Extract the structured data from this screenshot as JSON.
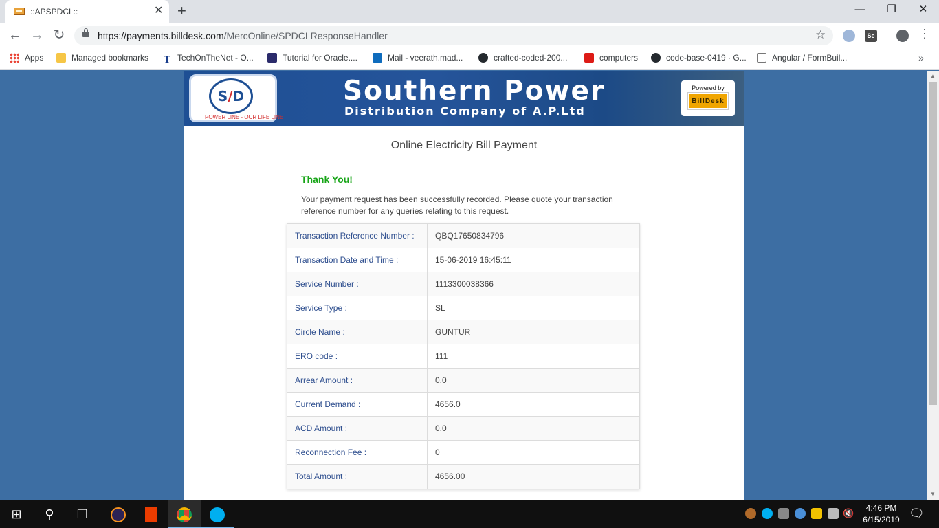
{
  "browser": {
    "tab_title": "::APSPDCL::",
    "tab_close": "✕",
    "new_tab": "+",
    "url_host": "https://payments.billdesk.com",
    "url_path": "/MercOnline/SPDCLResponseHandler",
    "bookmarks": [
      {
        "label": "Apps",
        "icon": "apps-grid-icon"
      },
      {
        "label": "Managed bookmarks",
        "icon": "folder-icon"
      },
      {
        "label": "TechOnTheNet - O...",
        "icon": "techonthenet-icon"
      },
      {
        "label": "Tutorial for Oracle....",
        "icon": "play-icon"
      },
      {
        "label": "Mail - veerath.mad...",
        "icon": "outlook-icon"
      },
      {
        "label": "crafted-coded-200...",
        "icon": "github-icon"
      },
      {
        "label": "computers",
        "icon": "angular-icon"
      },
      {
        "label": "code-base-0419 · G...",
        "icon": "github-icon"
      },
      {
        "label": "Angular / FormBuil...",
        "icon": "search-page-icon"
      }
    ],
    "bookmarks_more": "»",
    "ext_se_label": "Se"
  },
  "banner": {
    "logo_text_s": "S",
    "logo_text_slash": "/",
    "logo_text_d": "D",
    "logo_tagline": "POWER LINE - OUR LIFE LINE",
    "title": "Southern Power",
    "subtitle": "Distribution Company of A.P.Ltd",
    "powered_by": "Powered by",
    "billdesk": "BillDesk"
  },
  "page": {
    "heading": "Online Electricity Bill Payment",
    "thank_you": "Thank You!",
    "message": "Your payment request has been successfully recorded. Please quote your transaction reference number for any queries relating to this request."
  },
  "details": [
    {
      "label": "Transaction Reference Number :",
      "value": "QBQ17650834796"
    },
    {
      "label": "Transaction Date and Time :",
      "value": "15-06-2019 16:45:11"
    },
    {
      "label": "Service Number :",
      "value": "1113300038366"
    },
    {
      "label": "Service Type :",
      "value": "SL"
    },
    {
      "label": "Circle Name :",
      "value": "GUNTUR"
    },
    {
      "label": "ERO code :",
      "value": "111"
    },
    {
      "label": "Arrear Amount :",
      "value": "0.0"
    },
    {
      "label": "Current Demand :",
      "value": "4656.0"
    },
    {
      "label": "ACD Amount :",
      "value": "0.0"
    },
    {
      "label": "Reconnection Fee :",
      "value": "0"
    },
    {
      "label": "Total Amount :",
      "value": "4656.00"
    }
  ],
  "taskbar": {
    "time": "4:46 PM",
    "date": "6/15/2019"
  },
  "colors": {
    "banner_blue": "#1e4f94",
    "success_green": "#18a518",
    "label_blue": "#2f4f8f",
    "page_bg": "#3d6ea3"
  }
}
